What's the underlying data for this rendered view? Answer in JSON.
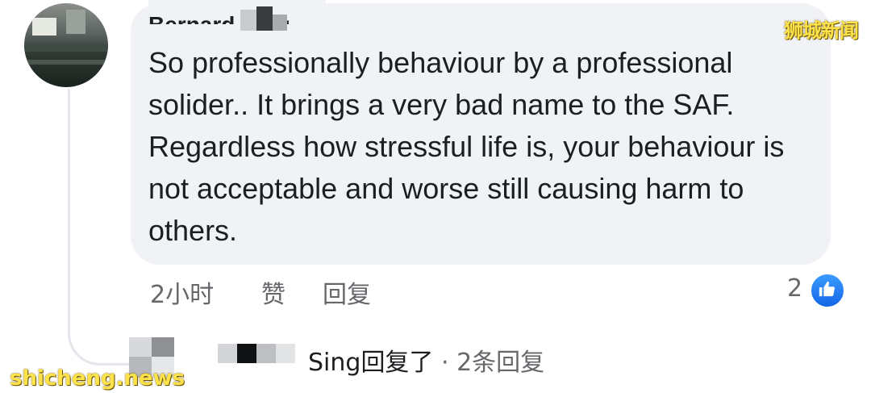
{
  "comment": {
    "author": "Bernard Sing",
    "text": "So professionally behaviour by a professional solider.. It brings a very bad name to the SAF. Regardless how stressful life is, your behaviour is not acceptable and worse still causing harm to others.",
    "time": "2小时",
    "like_label": "赞",
    "reply_label": "回复",
    "reaction_count": "2",
    "reaction_icon": "thumbs-up-icon",
    "accent_color": "#1877f2",
    "bubble_color": "#f0f2f5"
  },
  "reply_summary": {
    "name_fragment": "Sing",
    "action": "回复了",
    "separator": "·",
    "count_label": "2条回复"
  },
  "watermarks": {
    "top_right": "狮城新闻",
    "bottom_left": "shicheng.news"
  }
}
